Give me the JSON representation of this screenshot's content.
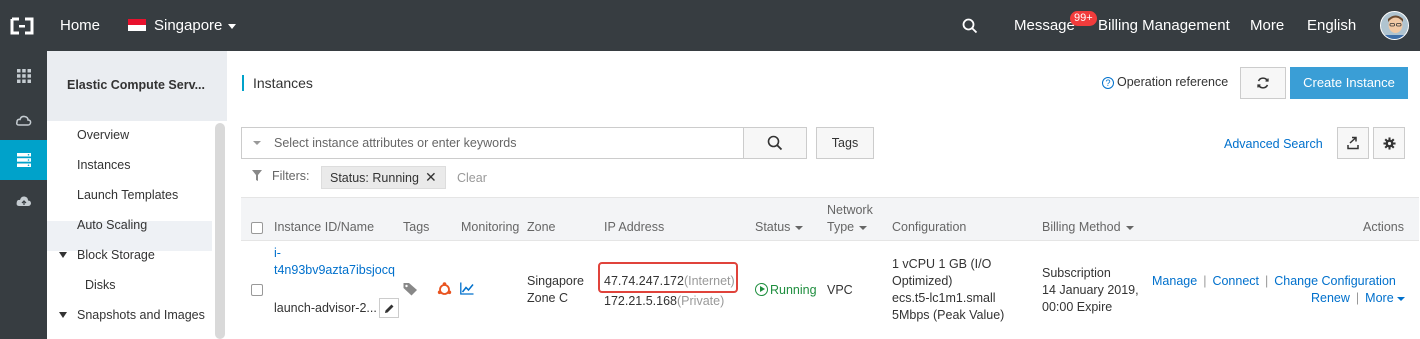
{
  "topbar": {
    "home": "Home",
    "region": "Singapore",
    "message": "Message",
    "message_badge": "99+",
    "billing": "Billing Management",
    "more": "More",
    "language": "English"
  },
  "sidebar": {
    "title": "Elastic Compute Serv...",
    "items": [
      {
        "label": "Overview"
      },
      {
        "label": "Instances"
      },
      {
        "label": "Launch Templates"
      },
      {
        "label": "Auto Scaling"
      },
      {
        "label": "Block Storage"
      },
      {
        "label": "Disks"
      },
      {
        "label": "Snapshots and Images"
      }
    ]
  },
  "main": {
    "title": "Instances",
    "operation_reference": "Operation reference",
    "create_instance": "Create Instance",
    "search_placeholder": "Select instance attributes or enter keywords",
    "tags_button": "Tags",
    "advanced_search": "Advanced Search",
    "filters_label": "Filters:",
    "filter_chip": "Status: Running",
    "clear": "Clear"
  },
  "table": {
    "headers": {
      "instance": "Instance ID/Name",
      "tags": "Tags",
      "monitoring": "Monitoring",
      "zone": "Zone",
      "ip": "IP Address",
      "status": "Status",
      "network_type_1": "Network",
      "network_type_2": "Type",
      "configuration": "Configuration",
      "billing": "Billing Method",
      "actions": "Actions"
    },
    "row": {
      "id_line1": "i-",
      "id_line2": "t4n93bv9azta7ibsjocq",
      "name": "launch-advisor-2...",
      "zone_1": "Singapore",
      "zone_2": "Zone C",
      "ip_public": "47.74.247.172",
      "ip_public_tag": "(Internet)",
      "ip_private": "172.21.5.168",
      "ip_private_tag": "(Private)",
      "status": "Running",
      "network_type": "VPC",
      "config_1": "1 vCPU 1 GB (I/O",
      "config_2": "Optimized)",
      "config_3": "ecs.t5-lc1m1.small",
      "config_4": "5Mbps (Peak Value)",
      "billing_1": "Subscription",
      "billing_2": "14 January 2019,",
      "billing_3": "00:00 Expire",
      "actions": {
        "manage": "Manage",
        "connect": "Connect",
        "change_config": "Change Configuration",
        "renew": "Renew",
        "more": "More"
      }
    }
  },
  "colors": {
    "topbar": "#373d41",
    "accent": "#00a2ca",
    "primary_button": "#3a9ed6",
    "link": "#0070cc",
    "running": "#1e8e3e",
    "highlight": "#e0433b"
  }
}
